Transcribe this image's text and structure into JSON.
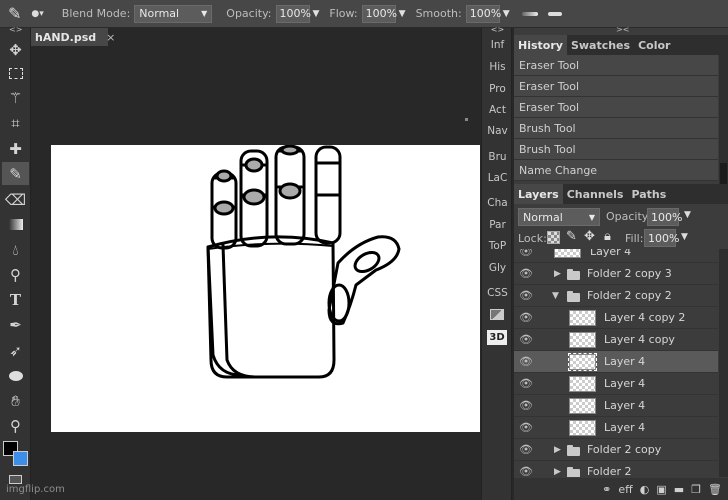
{
  "topbar": {
    "blend_label": "Blend Mode:",
    "blend_value": "Normal",
    "opacity_label": "Opacity:",
    "opacity_value": "100%",
    "flow_label": "Flow:",
    "flow_value": "100%",
    "smooth_label": "Smooth:",
    "smooth_value": "100%"
  },
  "tools": [
    "move-tool",
    "marquee-tool",
    "magic-wand-tool",
    "crop-tool",
    "heal-tool",
    "brush-tool",
    "eraser-tool",
    "gradient-tool",
    "blur-tool",
    "dodge-tool",
    "type-tool",
    "pen-tool",
    "path-select-tool",
    "shape-tool",
    "hand-tool",
    "zoom-tool"
  ],
  "document": {
    "tab_title": "hAND.psd",
    "close_glyph": "×"
  },
  "mini_panels": [
    "Inf",
    "His",
    "Pro",
    "Act",
    "Nav",
    "Bru",
    "LaC",
    "Cha",
    "Par",
    "ToP",
    "Gly",
    "CSS",
    "3D"
  ],
  "history_panel": {
    "tabs": [
      "History",
      "Swatches",
      "Color"
    ],
    "items": [
      "Eraser Tool",
      "Eraser Tool",
      "Eraser Tool",
      "Brush Tool",
      "Brush Tool",
      "Name Change"
    ]
  },
  "layers_panel": {
    "tabs": [
      "Layers",
      "Channels",
      "Paths"
    ],
    "blend_value": "Normal",
    "opacity_label": "Opacity:",
    "opacity_value": "100%",
    "lock_label": "Lock:",
    "fill_label": "Fill:",
    "fill_value": "100%",
    "layers": [
      {
        "name": "Layer 4",
        "kind": "layer",
        "indent": 1
      },
      {
        "name": "Folder 2 copy 3",
        "kind": "folder-closed",
        "indent": 1
      },
      {
        "name": "Folder 2 copy 2",
        "kind": "folder-open",
        "indent": 1
      },
      {
        "name": "Layer 4 copy 2",
        "kind": "layer",
        "indent": 2
      },
      {
        "name": "Layer 4 copy",
        "kind": "layer",
        "indent": 2
      },
      {
        "name": "Layer 4",
        "kind": "layer",
        "indent": 2,
        "selected": true
      },
      {
        "name": "Layer 4",
        "kind": "layer",
        "indent": 2
      },
      {
        "name": "Layer 4",
        "kind": "layer",
        "indent": 2
      },
      {
        "name": "Layer 4",
        "kind": "layer",
        "indent": 2
      },
      {
        "name": "Folder 2 copy",
        "kind": "folder-closed",
        "indent": 1
      },
      {
        "name": "Folder 2",
        "kind": "folder-closed",
        "indent": 1
      }
    ],
    "footer_eff": "eff"
  },
  "watermark": "imgflip.com",
  "colors": {
    "foreground": "#000000",
    "background": "#3d8ee8",
    "panel_bg": "#3c3c3c",
    "selected_row": "#5a5a5a"
  }
}
